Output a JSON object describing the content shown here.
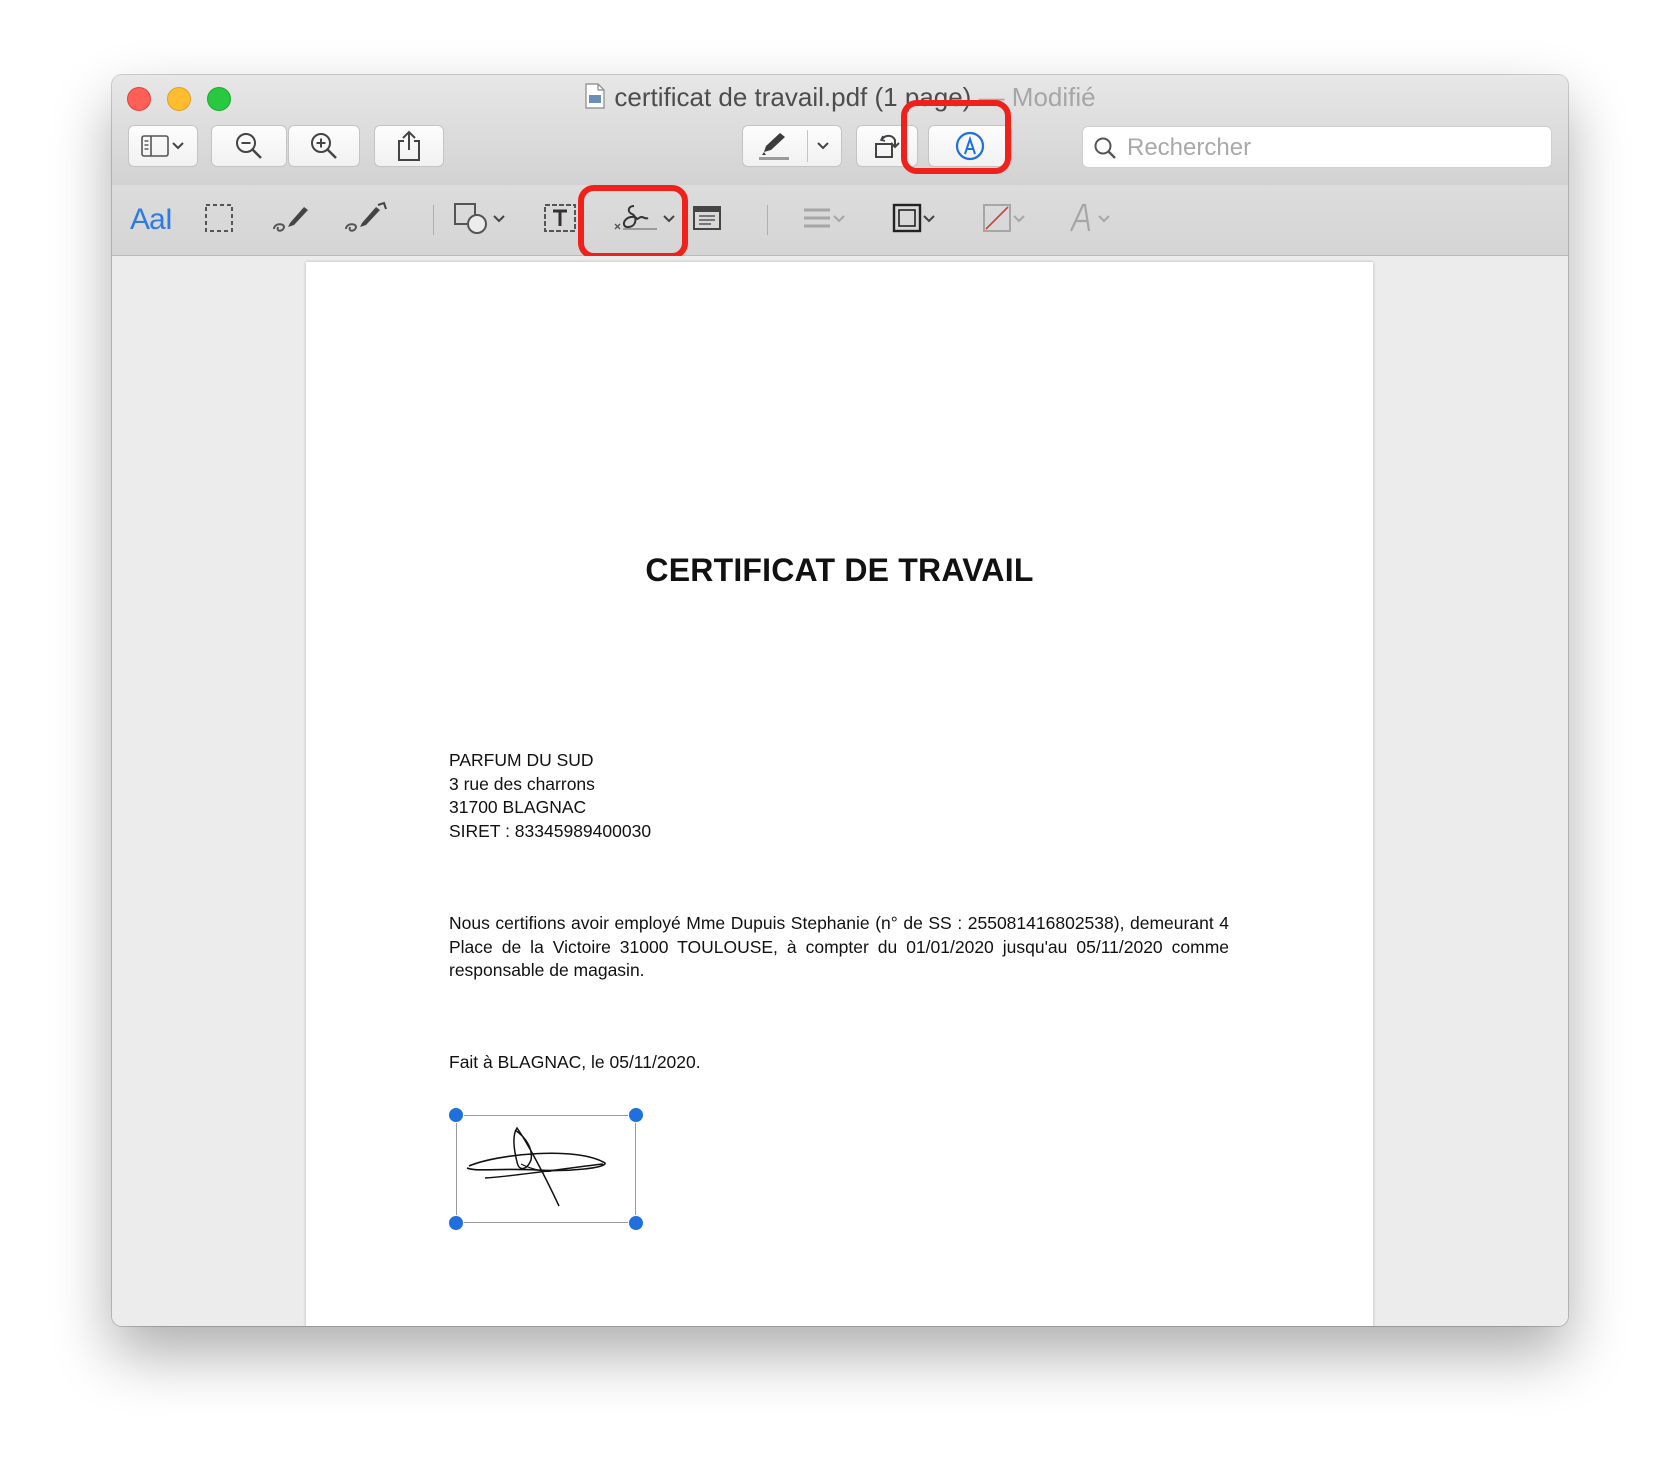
{
  "window": {
    "title": "certificat de travail.pdf (1 page)",
    "title_separator": "—",
    "modified_label": "Modifié"
  },
  "toolbar": {
    "search_placeholder": "Rechercher",
    "icons": [
      "sidebar-icon",
      "chevron-down-icon",
      "zoom-out-icon",
      "zoom-in-icon",
      "share-icon",
      "highlight-pen-icon",
      "chevron-down-icon",
      "rotate-icon",
      "markup-icon",
      "search-icon"
    ]
  },
  "markup_toolbar": {
    "text_selection_label": "AaI",
    "icons": [
      "rectangular-selection-icon",
      "sketch-icon",
      "draw-icon",
      "shapes-icon",
      "text-box-icon",
      "signature-icon",
      "note-icon",
      "shape-style-icon",
      "border-color-icon",
      "fill-color-icon",
      "text-style-icon"
    ]
  },
  "highlight_color": "#f0201a",
  "document": {
    "title": "CERTIFICAT DE TRAVAIL",
    "address": [
      "PARFUM DU SUD",
      "3 rue des charrons",
      "31700 BLAGNAC",
      "SIRET : 83345989400030"
    ],
    "body": "Nous certifions avoir employé Mme Dupuis Stephanie (n° de SS : 255081416802538), demeurant 4 Place de la Victoire 31000 TOULOUSE, à compter du 01/01/2020 jusqu'au 05/11/2020 comme responsable de magasin.",
    "fait": "Fait à BLAGNAC, le 05/11/2020."
  }
}
